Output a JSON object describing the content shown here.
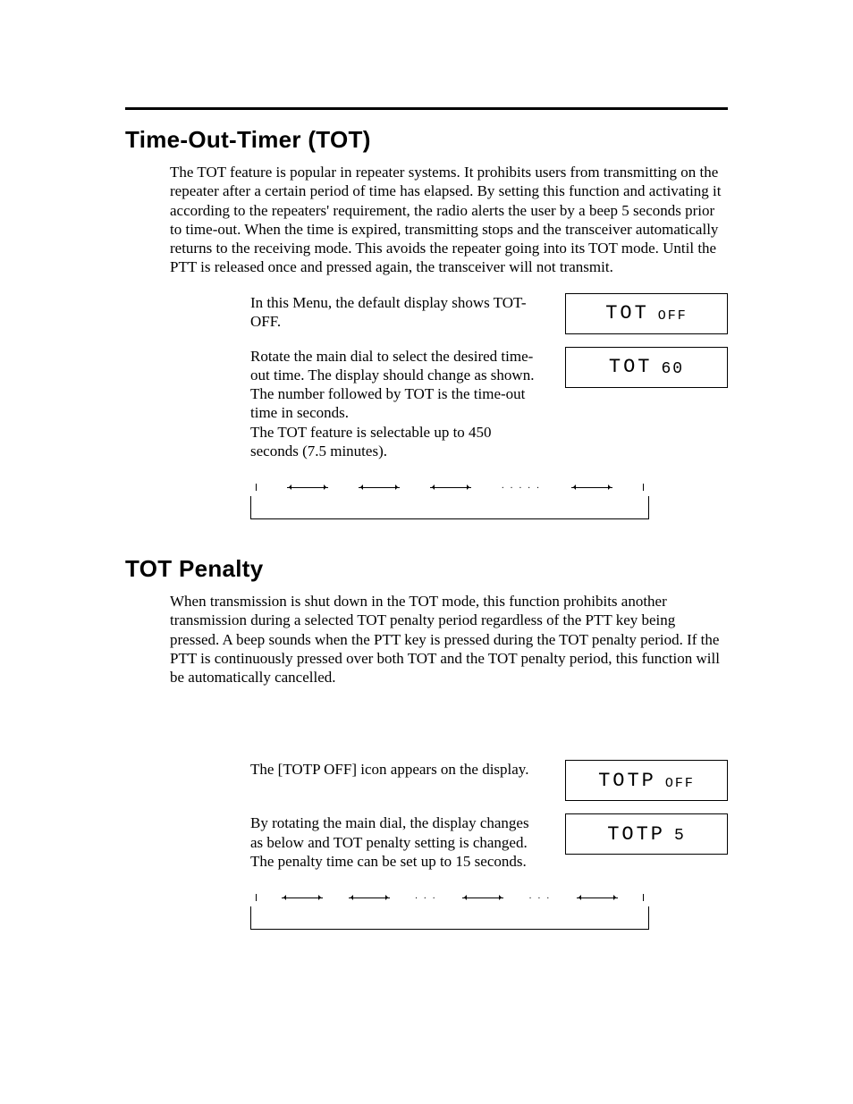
{
  "section1": {
    "title": "Time-Out-Timer (TOT)",
    "intro": "The TOT feature is popular in repeater systems. It prohibits users from transmitting on the repeater after a certain period of time has elapsed. By setting this function and activating it according to the repeaters' requirement, the radio alerts the user by a beep 5 seconds prior to time-out. When the time is expired, transmitting stops and the transceiver automatically returns to the receiving mode. This avoids the repeater going into its TOT mode. Until the PTT is released once and pressed again, the transceiver will not transmit.",
    "step1_text": "In this Menu, the default display shows TOT-OFF.",
    "step1_lcd_main": "TOT",
    "step1_lcd_sub": "OFF",
    "step2_text": "Rotate the main dial to select the desired time-out time. The display should change as shown. The number followed by TOT is the time-out time in seconds.\nThe TOT feature is selectable up to 450 seconds (7.5 minutes).",
    "step2_lcd_main": "TOT",
    "step2_lcd_sub": "60"
  },
  "section2": {
    "title": "TOT Penalty",
    "intro": "When transmission is shut down in the TOT mode, this function prohibits another transmission during a selected TOT penalty period regardless of the PTT key being pressed.  A beep sounds when the PTT key is pressed during the TOT penalty period. If the PTT is continuously pressed over both TOT and the TOT penalty period, this function will be automatically cancelled.",
    "step1_text": "The [TOTP OFF] icon appears on the display.",
    "step1_lcd_main": "TOTP",
    "step1_lcd_sub": "OFF",
    "step2_text": "By rotating the main dial, the display changes as below and TOT penalty setting is changed. The penalty time can be set up to 15 seconds.",
    "step2_lcd_main": "TOTP",
    "step2_lcd_sub": "5"
  }
}
